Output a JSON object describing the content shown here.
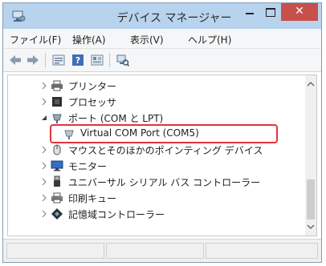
{
  "window": {
    "title": "デバイス マネージャー",
    "close_glyph": "✕"
  },
  "menu": [
    {
      "label": "ファイル(F)"
    },
    {
      "label": "操作(A)"
    },
    {
      "label": "表示(V)"
    },
    {
      "label": "ヘルプ(H)"
    }
  ],
  "toolbar": {
    "buttons": [
      "back-arrow-icon",
      "forward-arrow-icon",
      "properties-icon",
      "help-icon",
      "view-icon",
      "scan-hardware-icon"
    ]
  },
  "tree": {
    "items": [
      {
        "label": "プリンター",
        "expanded": false,
        "level": 1,
        "icon": "printer-icon"
      },
      {
        "label": "プロセッサ",
        "expanded": false,
        "level": 1,
        "icon": "processor-icon"
      },
      {
        "label": "ポート (COM と LPT)",
        "expanded": true,
        "level": 1,
        "icon": "port-icon"
      },
      {
        "label": "Virtual COM Port (COM5)",
        "level": 2,
        "icon": "com-port-icon",
        "highlighted": true
      },
      {
        "label": "マウスとそのほかのポインティング デバイス",
        "expanded": false,
        "level": 1,
        "icon": "mouse-icon"
      },
      {
        "label": "モニター",
        "expanded": false,
        "level": 1,
        "icon": "monitor-icon"
      },
      {
        "label": "ユニバーサル シリアル バス コントローラー",
        "expanded": false,
        "level": 1,
        "icon": "usb-icon"
      },
      {
        "label": "印刷キュー",
        "expanded": false,
        "level": 1,
        "icon": "print-queue-icon"
      },
      {
        "label": "記憶域コントローラー",
        "expanded": false,
        "level": 1,
        "icon": "storage-controller-icon"
      }
    ]
  },
  "colors": {
    "titlebar": "#b8d3ee",
    "close_button": "#c7504b",
    "highlight_border": "#e2343c"
  }
}
